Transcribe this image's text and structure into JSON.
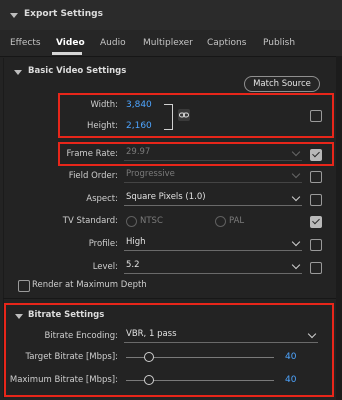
{
  "header": {
    "title": "Export Settings"
  },
  "tabs": [
    "Effects",
    "Video",
    "Audio",
    "Multiplexer",
    "Captions",
    "Publish"
  ],
  "basic": {
    "title": "Basic Video Settings",
    "match_source": "Match Source",
    "width_label": "Width:",
    "width_value": "3,840",
    "height_label": "Height:",
    "height_value": "2,160",
    "frame_rate_label": "Frame Rate:",
    "frame_rate_value": "29.97",
    "field_order_label": "Field Order:",
    "field_order_value": "Progressive",
    "aspect_label": "Aspect:",
    "aspect_value": "Square Pixels (1.0)",
    "tv_standard_label": "TV Standard:",
    "tv_ntsc": "NTSC",
    "tv_pal": "PAL",
    "profile_label": "Profile:",
    "profile_value": "High",
    "level_label": "Level:",
    "level_value": "5.2",
    "render_max_depth": "Render at Maximum Depth"
  },
  "bitrate": {
    "title": "Bitrate Settings",
    "encoding_label": "Bitrate Encoding:",
    "encoding_value": "VBR, 1 pass",
    "target_label": "Target Bitrate [Mbps]:",
    "target_value": "40",
    "max_label": "Maximum Bitrate [Mbps]:",
    "max_value": "40"
  },
  "colors": {
    "accent_blue": "#4ea5ff",
    "highlight_red": "#e8261a"
  }
}
